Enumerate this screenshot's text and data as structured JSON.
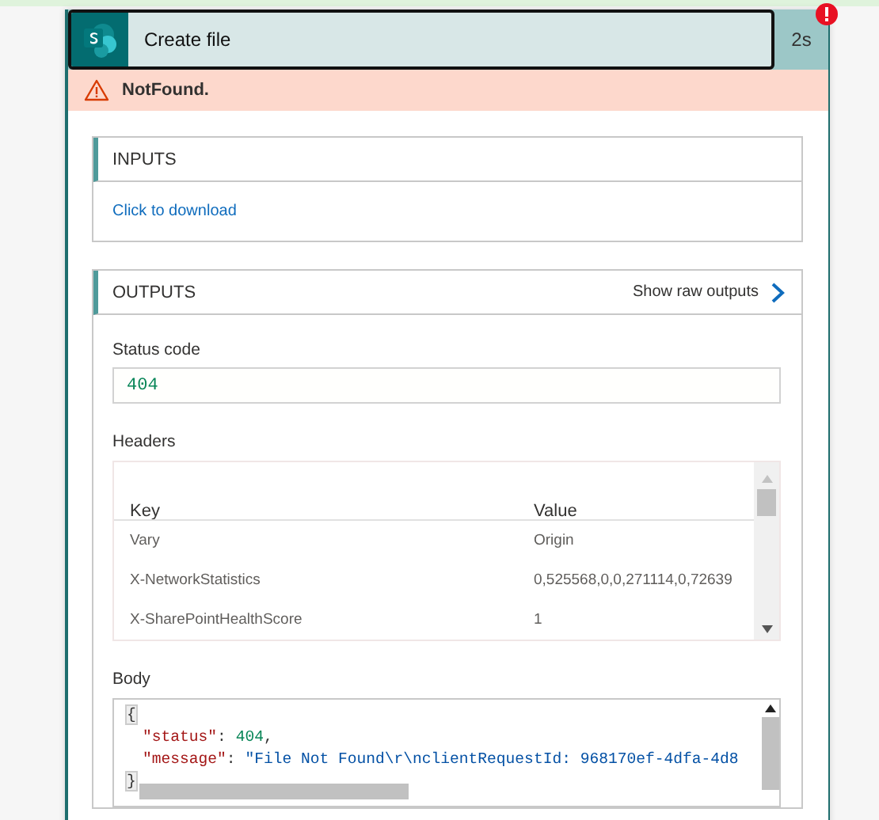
{
  "action": {
    "title": "Create file",
    "duration": "2s",
    "has_error": true
  },
  "error": {
    "message": "NotFound."
  },
  "inputs": {
    "title": "INPUTS",
    "link": "Click to download"
  },
  "outputs": {
    "title": "OUTPUTS",
    "raw_link": "Show raw outputs",
    "status_code": {
      "label": "Status code",
      "value": "404"
    },
    "headers": {
      "label": "Headers",
      "columns": [
        "Key",
        "Value"
      ],
      "rows": [
        {
          "key": "Vary",
          "value": "Origin"
        },
        {
          "key": "X-NetworkStatistics",
          "value": "0,525568,0,0,271114,0,72639"
        },
        {
          "key": "X-SharePointHealthScore",
          "value": "1"
        }
      ]
    },
    "body": {
      "label": "Body",
      "lines": [
        [
          {
            "kind": "brace",
            "text": "{"
          }
        ],
        [
          {
            "kind": "key",
            "text": "\"status\""
          },
          {
            "kind": "punct",
            "text": ": "
          },
          {
            "kind": "number",
            "text": "404"
          },
          {
            "kind": "punct",
            "text": ","
          }
        ],
        [
          {
            "kind": "key",
            "text": "\"message\""
          },
          {
            "kind": "punct",
            "text": ": "
          },
          {
            "kind": "string",
            "text": "\"File Not Found\\r\\nclientRequestId: 968170ef-4dfa-4d8"
          }
        ],
        [
          {
            "kind": "brace",
            "text": "}"
          }
        ]
      ]
    }
  }
}
